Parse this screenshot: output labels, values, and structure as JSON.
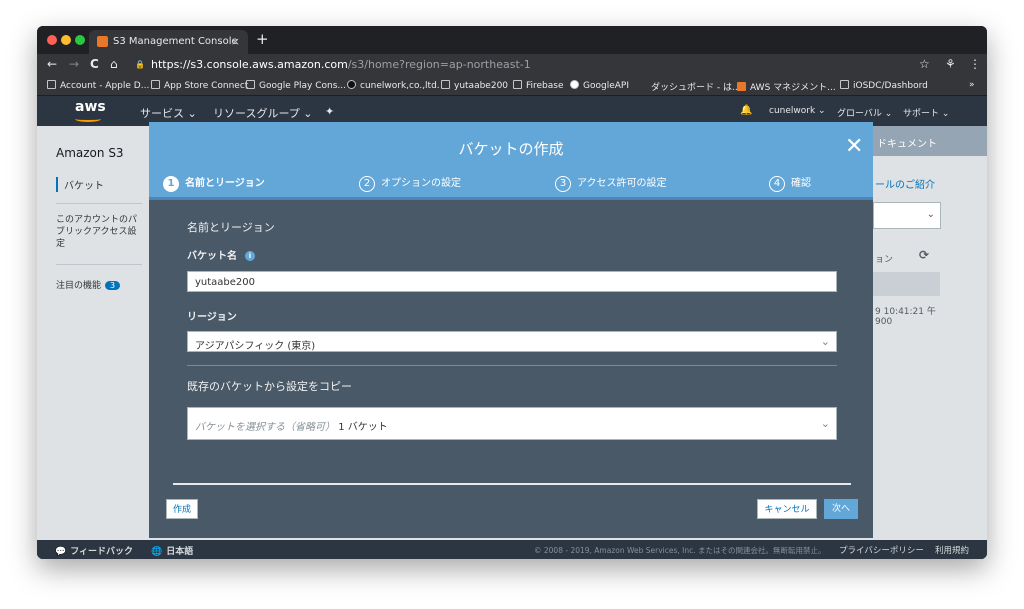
{
  "browser": {
    "tab_title": "S3 Management Console",
    "tab_close": "×",
    "new_tab": "+",
    "url_host": "https://s3.console.aws.amazon.com",
    "url_path": "/s3/home?region=ap-northeast-1",
    "nav_back": "←",
    "nav_forward": "→",
    "nav_reload": "C",
    "nav_home": "⌂",
    "lock": "🔒",
    "star": "☆",
    "ext": "⚘",
    "menu": "⋮",
    "bookmarks": [
      "Account - Apple D...",
      "App Store Connect",
      "Google Play Cons...",
      "cunelwork,co.,ltd.",
      "yutaabe200",
      "Firebase",
      "GoogleAPI",
      "ダッシュボード - は...",
      "AWS マネジメント...",
      "iOSDC/Dashbord"
    ],
    "bookmarks_more": "»"
  },
  "aws_nav": {
    "logo": "aws",
    "services": "サービス ⌄",
    "resource_groups": "リソースグループ ⌄",
    "pin": "✦",
    "bell": "🔔",
    "user": "cunelwork ⌄",
    "region": "グローバル ⌄",
    "support": "サポート ⌄"
  },
  "sidebar": {
    "title": "Amazon S3",
    "buckets": "バケット",
    "public_access": "このアカウントのパブリックアクセス設定",
    "featured": "注目の機能",
    "featured_count": "3"
  },
  "right_bg": {
    "docs": "ドキュメント",
    "intro": "ールのご紹介",
    "region_col": "ョン",
    "refresh": "⟳",
    "date": "9 10:41:21 午",
    "date2": "900"
  },
  "modal": {
    "title": "バケットの作成",
    "close": "✕",
    "steps": [
      {
        "num": "1",
        "label": "名前とリージョン"
      },
      {
        "num": "2",
        "label": "オプションの設定"
      },
      {
        "num": "3",
        "label": "アクセス許可の設定"
      },
      {
        "num": "4",
        "label": "確認"
      }
    ],
    "section_title": "名前とリージョン",
    "bucket_name_label": "バケット名",
    "info_icon": "i",
    "bucket_name_value": "yutaabe200",
    "region_label": "リージョン",
    "region_value": "アジアパシフィック (東京)",
    "copy_label": "既存のバケットから設定をコピー",
    "copy_placeholder": "バケットを選択する（省略可）",
    "copy_count": "1 バケット",
    "create_button": "作成",
    "cancel_button": "キャンセル",
    "next_button": "次へ"
  },
  "footer": {
    "feedback": "フィードバック",
    "language": "日本語",
    "copyright": "© 2008 - 2019, Amazon Web Services, Inc. またはその関連会社。無断転用禁止。",
    "privacy": "プライバシーポリシー",
    "terms": "利用規約"
  },
  "colors": {
    "modal_header": "#63a7d9",
    "modal_body": "#4a5967",
    "aws_nav": "#2c3542",
    "primary_button": "#63a7d9"
  }
}
